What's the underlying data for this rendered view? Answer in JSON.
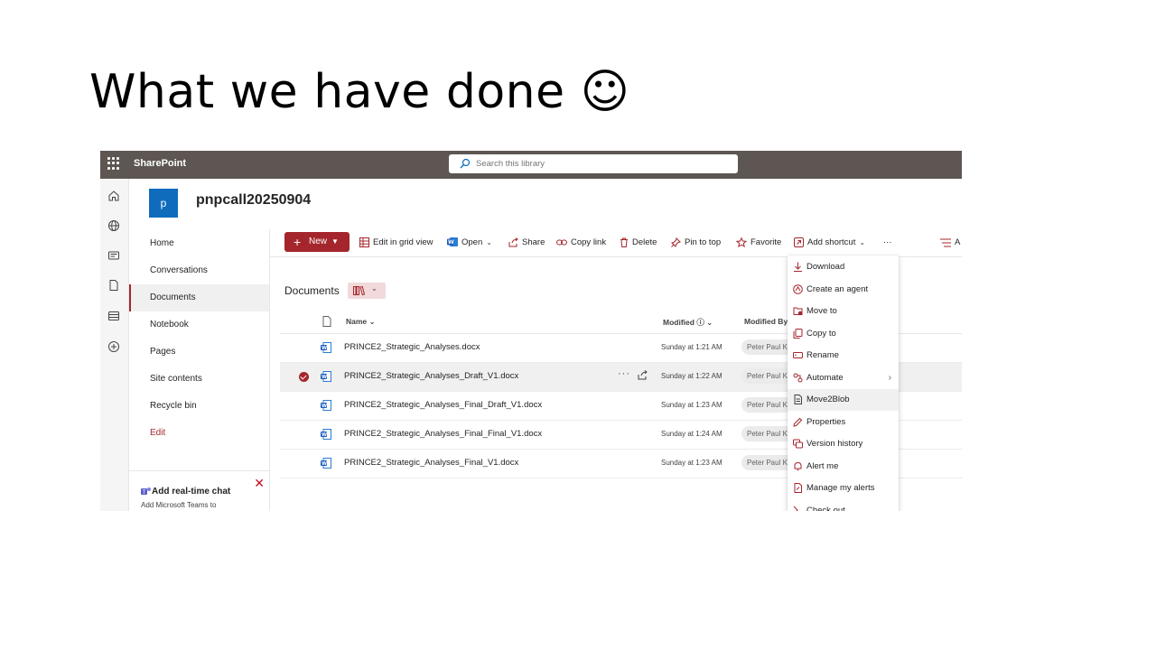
{
  "slide": {
    "title": "What we have done ☺"
  },
  "suitebar": {
    "app_name": "SharePoint",
    "search_placeholder": "Search this library"
  },
  "site": {
    "logo_letter": "p",
    "title": "pnpcall20250904"
  },
  "nav": {
    "items": [
      "Home",
      "Conversations",
      "Documents",
      "Notebook",
      "Pages",
      "Site contents",
      "Recycle bin",
      "Edit"
    ],
    "active": "Documents"
  },
  "chat_card": {
    "title": "Add real-time chat",
    "subtitle": "Add Microsoft Teams to"
  },
  "toolbar": {
    "new_label": "New",
    "edit_grid": "Edit in grid view",
    "open": "Open",
    "share": "Share",
    "copy_link": "Copy link",
    "delete": "Delete",
    "pin": "Pin to top",
    "favorite": "Favorite",
    "add_shortcut": "Add shortcut",
    "more": "···",
    "overflow_label": "A"
  },
  "library": {
    "title": "Documents",
    "columns": {
      "name": "Name",
      "modified": "Modified",
      "modified_by": "Modified By"
    },
    "rows": [
      {
        "name": "PRINCE2_Strategic_Analyses.docx",
        "modified": "Sunday at 1:21 AM",
        "modified_by": "Peter Paul Ka",
        "selected": false
      },
      {
        "name": "PRINCE2_Strategic_Analyses_Draft_V1.docx",
        "modified": "Sunday at 1:22 AM",
        "modified_by": "Peter Paul Ka",
        "selected": true
      },
      {
        "name": "PRINCE2_Strategic_Analyses_Final_Draft_V1.docx",
        "modified": "Sunday at 1:23 AM",
        "modified_by": "Peter Paul Ka",
        "selected": false
      },
      {
        "name": "PRINCE2_Strategic_Analyses_Final_Final_V1.docx",
        "modified": "Sunday at 1:24 AM",
        "modified_by": "Peter Paul Ka",
        "selected": false
      },
      {
        "name": "PRINCE2_Strategic_Analyses_Final_V1.docx",
        "modified": "Sunday at 1:23 AM",
        "modified_by": "Peter Paul Ka",
        "selected": false
      }
    ]
  },
  "context_menu": {
    "items": [
      "Download",
      "Create an agent",
      "Move to",
      "Copy to",
      "Rename",
      "Automate",
      "Move2Blob",
      "Properties",
      "Version history",
      "Alert me",
      "Manage my alerts",
      "Check out"
    ],
    "hovered": "Move2Blob"
  },
  "colors": {
    "accent": "#a4262c",
    "suitebar": "#5e5653",
    "site_logo": "#0f6cbd",
    "word_blue": "#185abd"
  }
}
